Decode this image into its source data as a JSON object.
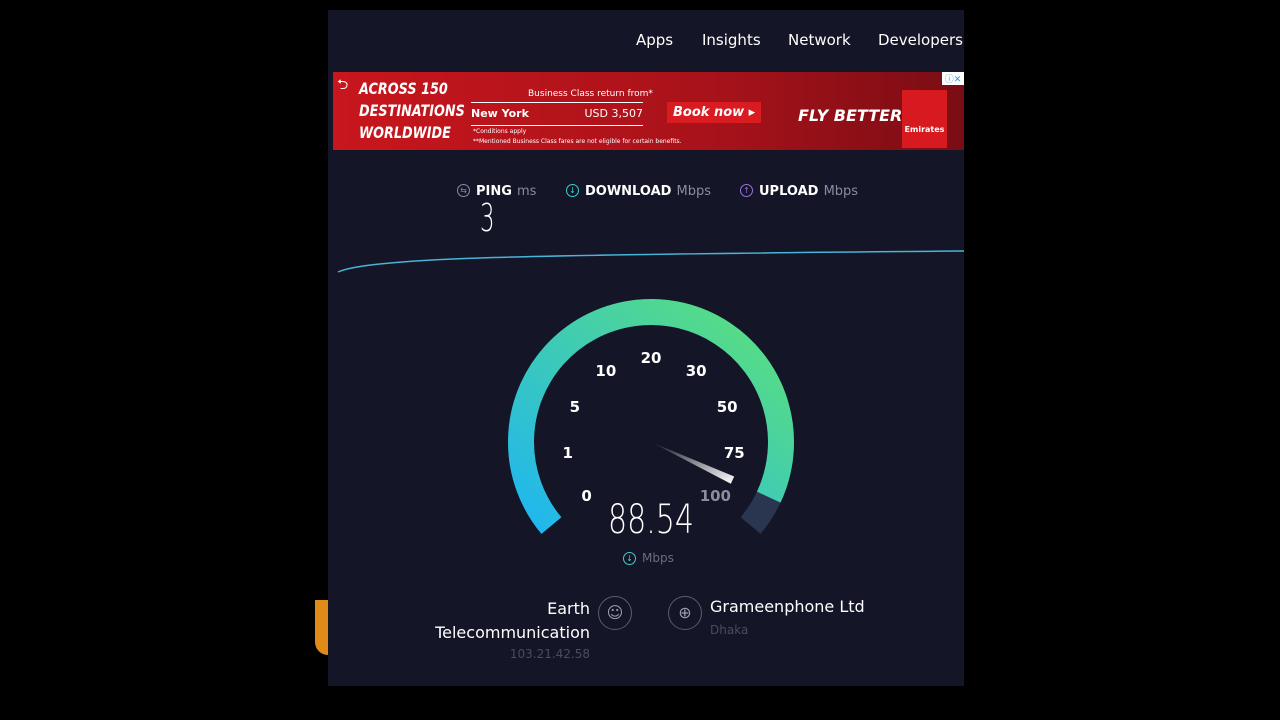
{
  "nav": [
    "Apps",
    "Insights",
    "Network",
    "Developers"
  ],
  "ad": {
    "headline": [
      "ACROSS 150",
      "DESTINATIONS",
      "WORLDWIDE"
    ],
    "offer_title": "Business Class return from*",
    "city": "New York",
    "price": "USD 3,507",
    "conditions": "*Conditions apply",
    "disclaimer": "**Mentioned Business Class fares are not eligible for certain benefits.",
    "cta": "Book now ▸",
    "slogan": "FLY BETTER",
    "brand": "Emirates"
  },
  "metrics": {
    "ping": {
      "label": "PING",
      "unit": "ms",
      "value": "3"
    },
    "download": {
      "label": "DOWNLOAD",
      "unit": "Mbps"
    },
    "upload": {
      "label": "UPLOAD",
      "unit": "Mbps"
    }
  },
  "gauge": {
    "ticks": [
      "0",
      "1",
      "5",
      "10",
      "20",
      "30",
      "50",
      "75",
      "100"
    ],
    "value": "88.54",
    "value_num": 88.54,
    "unit": "Mbps",
    "colors": {
      "start": "#1fb6f0",
      "end": "#5de07a",
      "track": "#2a3550"
    }
  },
  "provider": {
    "name_line1": "Earth",
    "name_line2": "Telecommunication",
    "ip": "103.21.42.58"
  },
  "server": {
    "name": "Grameenphone Ltd",
    "location": "Dhaka"
  }
}
